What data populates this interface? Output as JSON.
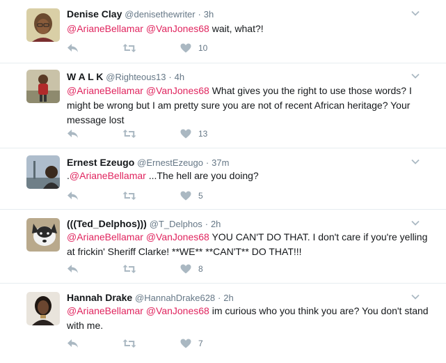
{
  "colors": {
    "mention": "#e0245e",
    "muted": "#657786",
    "icon": "#aab8c2"
  },
  "tweets": [
    {
      "name": "Denise Clay",
      "handle": "@denisethewriter",
      "sep": "·",
      "time": "3h",
      "m1": "@ArianeBellamar",
      "m2": "@VanJones68",
      "text": " wait, what?!",
      "likes": "10"
    },
    {
      "name": "W A L K",
      "handle": "@Righteous13",
      "sep": "·",
      "time": "4h",
      "m1": "@ArianeBellamar",
      "m2": "@VanJones68",
      "text": " What gives you the right to use those words? I might be wrong but I am pretty sure you are not of recent African heritage? Your message lost",
      "likes": "13"
    },
    {
      "name": "Ernest Ezeugo",
      "handle": "@ErnestEzeugo",
      "sep": "·",
      "time": "37m",
      "prefix": ".",
      "m1": "@ArianeBellamar",
      "text": " ...The hell are you doing?",
      "likes": "5"
    },
    {
      "name": "(((Ted_Delphos)))",
      "handle": "@T_Delphos",
      "sep": "·",
      "time": "2h",
      "m1": "@ArianeBellamar",
      "m2": "@VanJones68",
      "text": " YOU CAN'T DO THAT. I don't care if you're yelling at frickin' Sheriff Clarke! **WE** **CAN'T** DO THAT!!!",
      "likes": "8"
    },
    {
      "name": "Hannah Drake",
      "handle": "@HannahDrake628",
      "sep": "·",
      "time": "2h",
      "m1": "@ArianeBellamar",
      "m2": "@VanJones68",
      "text": " im curious who you think you are? You don't stand with me.",
      "likes": "7"
    }
  ]
}
